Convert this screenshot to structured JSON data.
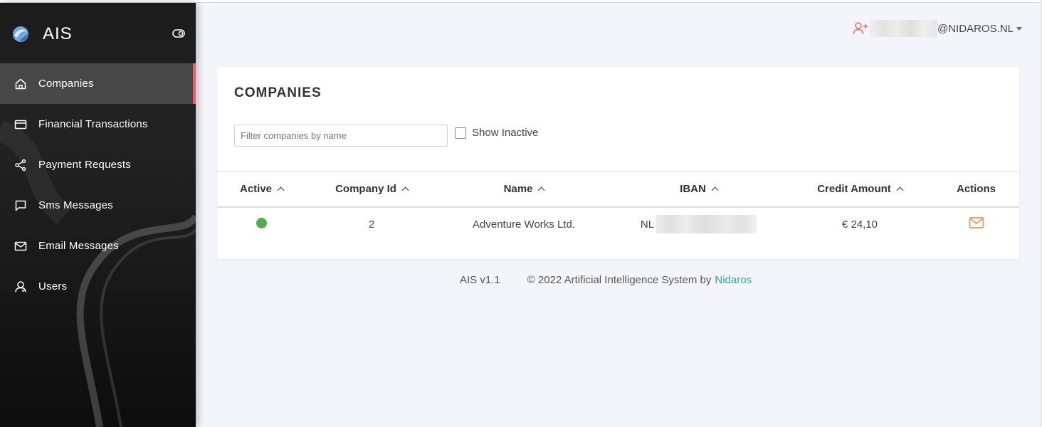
{
  "app": {
    "title": "AIS"
  },
  "sidebar": {
    "items": [
      {
        "label": "Companies",
        "icon": "home-icon",
        "active": true
      },
      {
        "label": "Financial Transactions",
        "icon": "credit-card-icon",
        "active": false
      },
      {
        "label": "Payment Requests",
        "icon": "share-icon",
        "active": false
      },
      {
        "label": "Sms Messages",
        "icon": "chat-icon",
        "active": false
      },
      {
        "label": "Email Messages",
        "icon": "mail-icon",
        "active": false
      },
      {
        "label": "Users",
        "icon": "user-icon",
        "active": false
      }
    ]
  },
  "header": {
    "user_domain": "@NIDAROS.NL",
    "user_icon": "user-add-icon"
  },
  "companies": {
    "title": "COMPANIES",
    "filter_placeholder": "Filter companies by name",
    "show_inactive_label": "Show Inactive",
    "show_inactive_checked": false,
    "columns": [
      "Active",
      "Company Id",
      "Name",
      "IBAN",
      "Credit Amount",
      "Actions"
    ],
    "rows": [
      {
        "active": true,
        "company_id": "2",
        "name": "Adventure Works Ltd.",
        "iban_prefix": "NL",
        "credit_amount": "€ 24,10",
        "action_icon": "mail-icon"
      }
    ]
  },
  "footer": {
    "version": "AIS v1.1",
    "copyright": "© 2022 Artificial Intelligence System by",
    "link": "Nidaros"
  },
  "colors": {
    "accent_active": "#ef5b6b",
    "status_active": "#4caf50",
    "user_icon": "#e8735a",
    "action_icon": "#f0944e",
    "link": "#2aa7a0"
  }
}
